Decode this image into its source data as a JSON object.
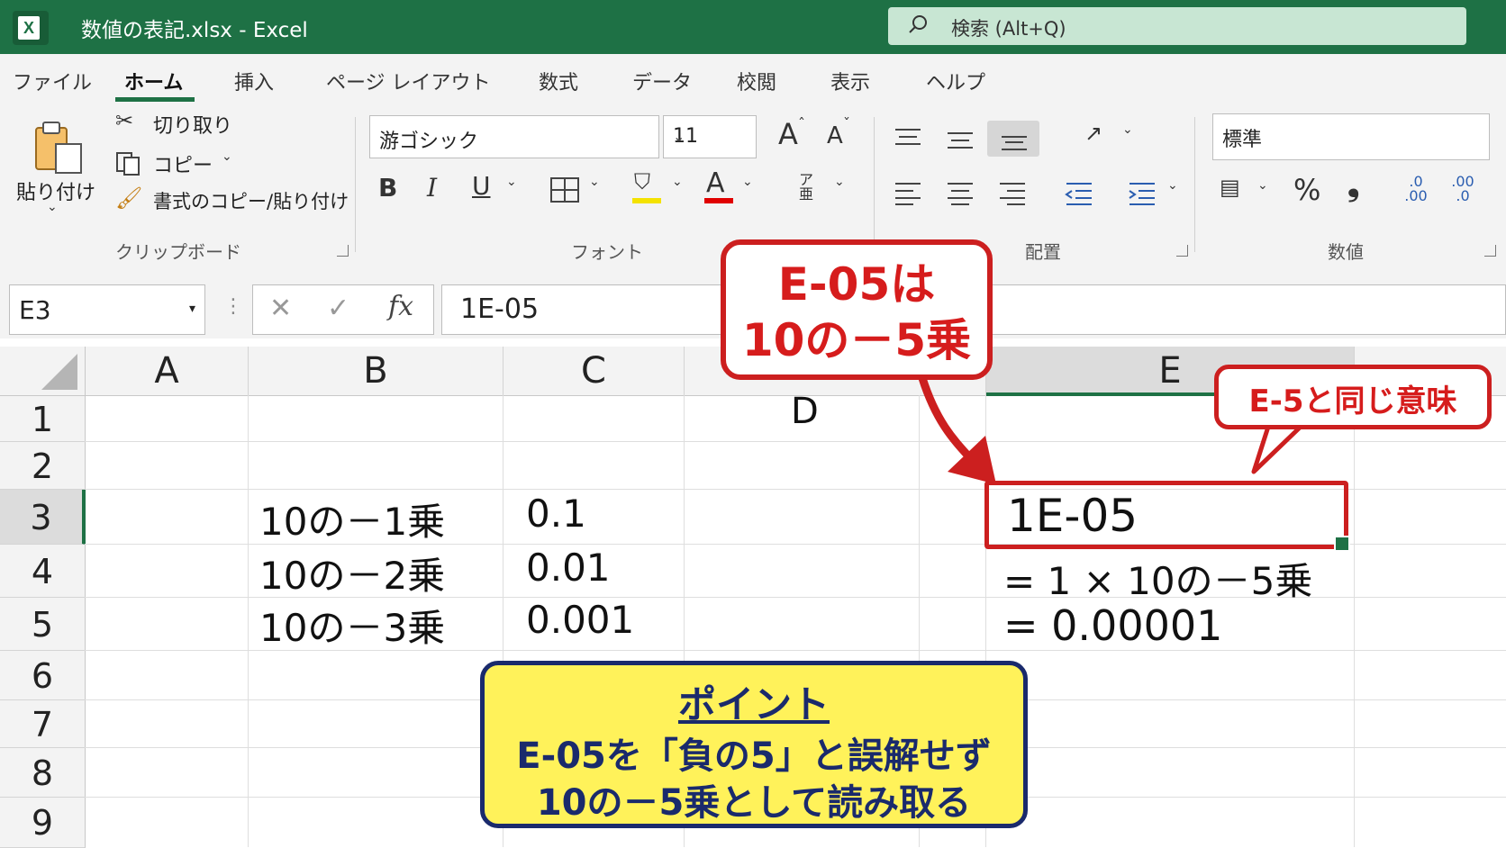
{
  "window": {
    "app_icon_letter": "X",
    "title": "数値の表記.xlsx  -  Excel",
    "search_placeholder": "検索 (Alt+Q)"
  },
  "menu": {
    "tabs": [
      "ファイル",
      "ホーム",
      "挿入",
      "ページ レイアウト",
      "数式",
      "データ",
      "校閲",
      "表示",
      "ヘルプ"
    ],
    "active": "ホーム"
  },
  "ribbon": {
    "clipboard": {
      "paste": "貼り付け",
      "cut": "切り取り",
      "copy": "コピー",
      "format_painter": "書式のコピー/貼り付け",
      "group_label": "クリップボード"
    },
    "font": {
      "font_name": "游ゴシック",
      "font_size": "11",
      "grow": "A",
      "shrink": "A",
      "bold": "B",
      "italic": "I",
      "underline": "U",
      "font_color_letter": "A",
      "phonetic": "ア亜",
      "group_label": "フォント"
    },
    "alignment": {
      "group_label": "配置"
    },
    "number": {
      "format": "標準",
      "percent": "%",
      "comma": "❟",
      "inc_decimal": ".0 .00",
      "dec_decimal": ".00 .0",
      "group_label": "数値"
    }
  },
  "formula_bar": {
    "name_box": "E3",
    "cancel": "✕",
    "enter": "✓",
    "fx": "fx",
    "formula": "1E-05"
  },
  "sheet": {
    "columns": [
      "A",
      "B",
      "C",
      "D",
      "E"
    ],
    "rows": [
      "1",
      "2",
      "3",
      "4",
      "5",
      "6",
      "7",
      "8",
      "9"
    ],
    "cells": {
      "B3": "10の－1乗",
      "B4": "10の－2乗",
      "B5": "10の－3乗",
      "C3": "0.1",
      "C4": "0.01",
      "C5": "0.001",
      "E3": "1E-05",
      "E4": "= 1 × 10の－5乗",
      "E5": "= 0.00001"
    },
    "stray_label": "D"
  },
  "annotations": {
    "callout_main_line1": "E-05は",
    "callout_main_line2": "10の－5乗",
    "callout_side": "E-5と同じ意味",
    "point_title": "ポイント",
    "point_line1": "E-05を「負の5」と誤解せず",
    "point_line2": "10の－5乗として読み取る",
    "colors": {
      "red": "#cc1f1f",
      "yellow": "#fff25a",
      "navy": "#1a2a6c",
      "excel_green": "#1e7145"
    }
  }
}
